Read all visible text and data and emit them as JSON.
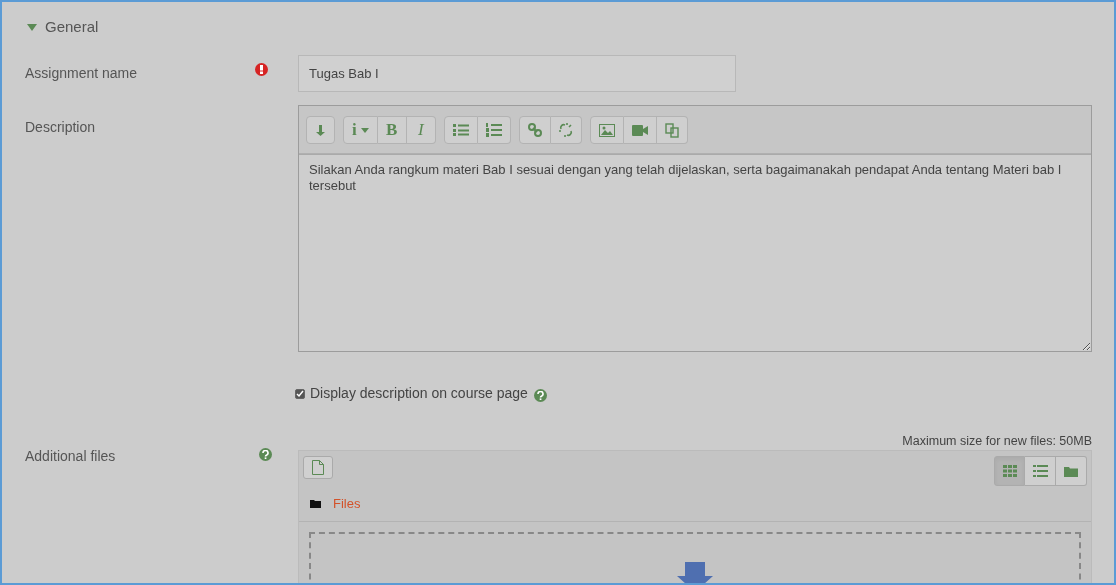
{
  "section": {
    "title": "General",
    "expanded": true
  },
  "assignment_name": {
    "label": "Assignment name",
    "required": true,
    "value": "Tugas Bab I"
  },
  "description": {
    "label": "Description",
    "toolbar": [
      [
        {
          "kind": "collapse"
        }
      ],
      [
        {
          "kind": "info",
          "label": "i",
          "dropdown": true
        },
        {
          "kind": "bold",
          "label": "B"
        },
        {
          "kind": "italic",
          "label": "I"
        }
      ],
      [
        {
          "kind": "bullets"
        },
        {
          "kind": "numbers"
        }
      ],
      [
        {
          "kind": "link"
        },
        {
          "kind": "unlink"
        }
      ],
      [
        {
          "kind": "image"
        },
        {
          "kind": "video"
        },
        {
          "kind": "copy"
        }
      ]
    ],
    "value": "Silakan Anda rangkum materi Bab I sesuai dengan yang telah dijelaskan, serta bagaimanakah pendapat Anda tentang Materi bab I tersebut"
  },
  "display_on_course_page": {
    "label": "Display description on course page",
    "checked": true
  },
  "additional_files": {
    "label": "Additional files",
    "max_size": "Maximum size for new files: 50MB",
    "folder": "Files",
    "views": [
      {
        "kind": "grid",
        "selected": true
      },
      {
        "kind": "list",
        "selected": false
      },
      {
        "kind": "tree",
        "selected": false
      }
    ]
  }
}
